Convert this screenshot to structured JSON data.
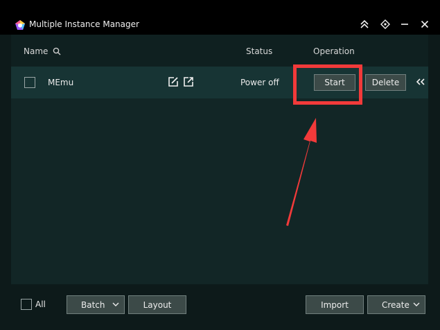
{
  "window": {
    "title": "Multiple Instance Manager"
  },
  "titlebar": {
    "buttons": [
      "collapse-up-icon",
      "pin-icon",
      "minimize-icon",
      "close-icon"
    ]
  },
  "table": {
    "headers": {
      "name": "Name",
      "status": "Status",
      "operation": "Operation"
    },
    "rows": [
      {
        "name": "MEmu",
        "status": "Power off",
        "start_label": "Start",
        "delete_label": "Delete"
      }
    ]
  },
  "footer": {
    "all_label": "All",
    "batch_label": "Batch",
    "layout_label": "Layout",
    "import_label": "Import",
    "create_label": "Create"
  },
  "colors": {
    "annotation_red": "#f23a3a",
    "button_bg": "#3c4a48",
    "row_bg": "#173434"
  }
}
